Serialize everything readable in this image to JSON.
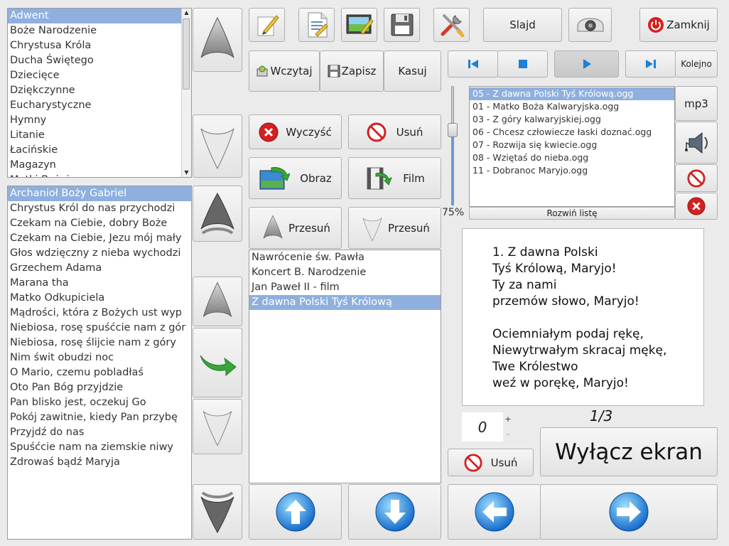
{
  "categories": {
    "items": [
      "Adwent",
      "Boże Narodzenie",
      "Chrystusa Króla",
      "Ducha Świętego",
      "Dziecięce",
      "Dziękczynne",
      "Eucharystyczne",
      "Hymny",
      "Litanie",
      "Łacińskie",
      "Magazyn",
      "Matki Bożej"
    ],
    "selected_index": 0
  },
  "songs": {
    "items": [
      "Archanioł Boży Gabriel",
      "Chrystus Król do nas przychodzi",
      "Czekam na Ciebie, dobry Boże",
      "Czekam na Ciebie, Jezu mój mały",
      "Głos wdzięczny z nieba wychodzi",
      "Grzechem Adama",
      "Marana tha",
      "Matko Odkupiciela",
      "Mądrości, która z Bożych ust wyp",
      "Niebiosa, rosę spuśćcie nam z gór",
      "Niebiosa, rosę ślijcie nam z góry",
      "Nim świt obudzi noc",
      "O Mario, czemu pobladłaś",
      "Oto Pan Bóg przyjdzie",
      "Pan blisko jest, oczekuj Go",
      "Pokój zawitnie, kiedy Pan przybę",
      "Przyjdź do nas",
      "Spuśćcie nam na ziemskie niwy",
      "Zdrowaś bądź Maryja"
    ],
    "selected_index": 0
  },
  "toolbar": {
    "slide_label": "Slajd",
    "close_label": "Zamknij",
    "load_label": "Wczytaj",
    "save_label": "Zapisz",
    "delete_label": "Kasuj"
  },
  "actions": {
    "clear_label": "Wyczyść",
    "remove_label": "Usuń",
    "image_label": "Obraz",
    "film_label": "Film",
    "move_up_label": "Przesuń",
    "move_down_label": "Przesuń"
  },
  "schedule": {
    "items": [
      "Nawrócenie św. Pawła",
      "Koncert B. Narodzenie",
      "Jan Paweł II - film",
      "Z dawna Polski Tyś Królową"
    ],
    "selected_index": 3
  },
  "player": {
    "order_label": "Kolejno",
    "volume_label": "75%",
    "volume": 0.75,
    "mp3_label": "mp3",
    "expand_label": "Rozwiń listę",
    "playlist": [
      "05 - Z dawna Polski Tyś Królową.ogg",
      "01 - Matko Boża Kalwaryjska.ogg",
      "03 - Z góry kalwaryjskiej.ogg",
      "06 - Chcesz człowiecze łaski doznać.ogg",
      "07 - Rozwija się kwiecie.ogg",
      "08 - Wziętaś do nieba.ogg",
      "11 - Dobranoc Maryjo.ogg"
    ],
    "selected_index": 0
  },
  "preview": {
    "lines": [
      "1. Z dawna Polski",
      "Tyś Królową, Maryjo!",
      "Ty za nami",
      "przemów słowo, Maryjo!",
      "",
      "Ociemniałym podaj rękę,",
      "Niewytrwałym skracaj mękę,",
      "Twe Królestwo",
      "weź w porękę, Maryjo!"
    ],
    "page_indicator": "1/3"
  },
  "controls": {
    "spin_value": "0",
    "spin_plus": "+",
    "spin_minus": "–",
    "remove_label": "Usuń",
    "screen_off_label": "Wyłącz ekran"
  },
  "colors": {
    "selection": "#8fb0de",
    "accent_blue": "#1e7fd6",
    "danger_red": "#d42020",
    "green_arrow": "#3aa53a"
  }
}
